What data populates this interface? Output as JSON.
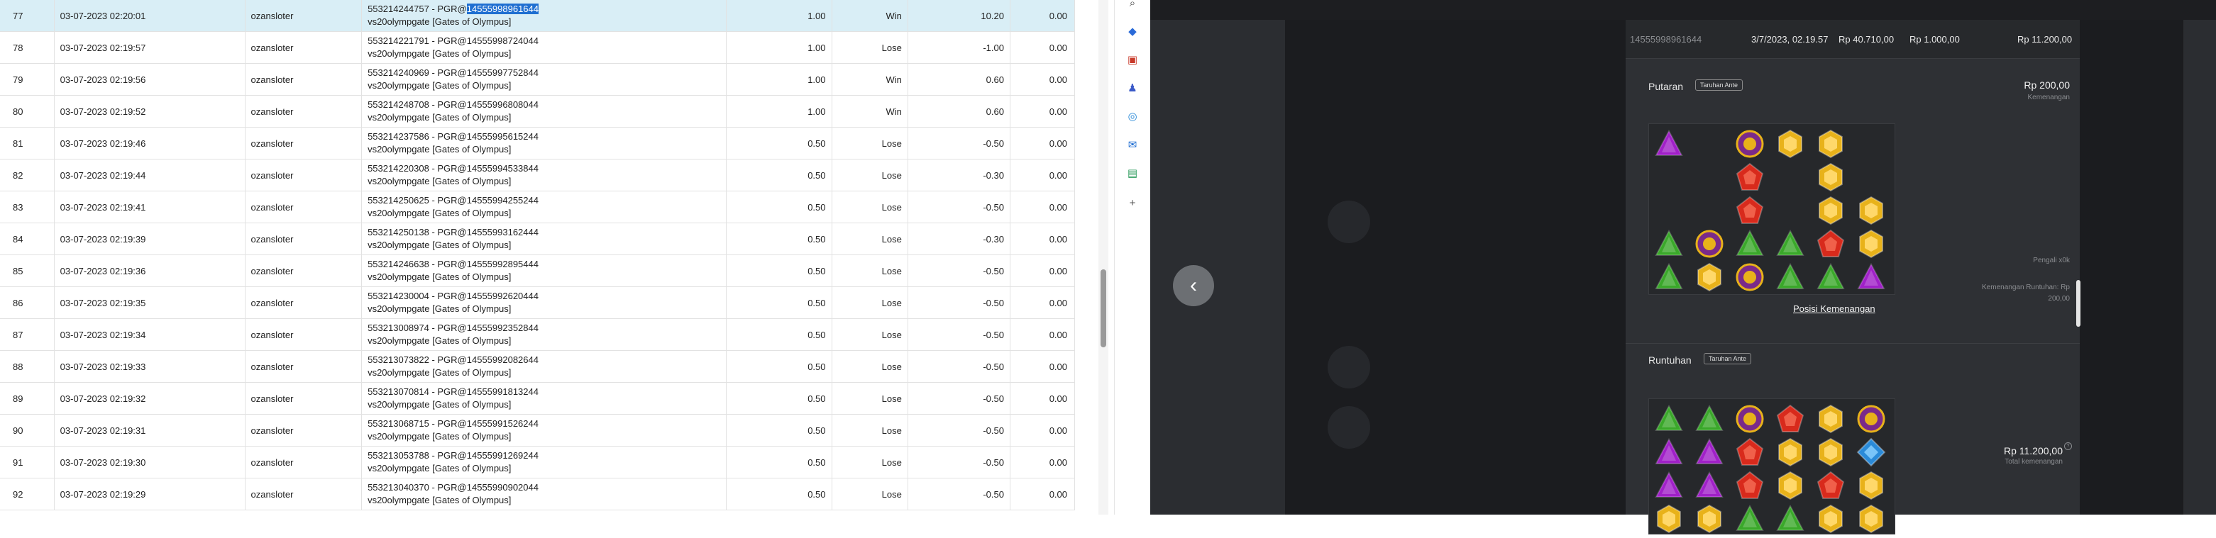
{
  "table": {
    "rows": [
      {
        "no": "77",
        "date": "03-07-2023 02:20:01",
        "user": "ozansloter",
        "tx_prefix": "553214244757 - PGR@",
        "tx_hl": "14555998961644",
        "game": "vs20olympgate [Gates of Olympus]",
        "bet": "1.00",
        "result": "Win",
        "win": "10.20",
        "extra": "0.00",
        "selected": true
      },
      {
        "no": "78",
        "date": "03-07-2023 02:19:57",
        "user": "ozansloter",
        "tx_prefix": "553214221791 - PGR@14555998724044",
        "tx_hl": "",
        "game": "vs20olympgate [Gates of Olympus]",
        "bet": "1.00",
        "result": "Lose",
        "win": "-1.00",
        "extra": "0.00"
      },
      {
        "no": "79",
        "date": "03-07-2023 02:19:56",
        "user": "ozansloter",
        "tx_prefix": "553214240969 - PGR@14555997752844",
        "tx_hl": "",
        "game": "vs20olympgate [Gates of Olympus]",
        "bet": "1.00",
        "result": "Win",
        "win": "0.60",
        "extra": "0.00"
      },
      {
        "no": "80",
        "date": "03-07-2023 02:19:52",
        "user": "ozansloter",
        "tx_prefix": "553214248708 - PGR@14555996808044",
        "tx_hl": "",
        "game": "vs20olympgate [Gates of Olympus]",
        "bet": "1.00",
        "result": "Win",
        "win": "0.60",
        "extra": "0.00"
      },
      {
        "no": "81",
        "date": "03-07-2023 02:19:46",
        "user": "ozansloter",
        "tx_prefix": "553214237586 - PGR@14555995615244",
        "tx_hl": "",
        "game": "vs20olympgate [Gates of Olympus]",
        "bet": "0.50",
        "result": "Lose",
        "win": "-0.50",
        "extra": "0.00"
      },
      {
        "no": "82",
        "date": "03-07-2023 02:19:44",
        "user": "ozansloter",
        "tx_prefix": "553214220308 - PGR@14555994533844",
        "tx_hl": "",
        "game": "vs20olympgate [Gates of Olympus]",
        "bet": "0.50",
        "result": "Lose",
        "win": "-0.30",
        "extra": "0.00"
      },
      {
        "no": "83",
        "date": "03-07-2023 02:19:41",
        "user": "ozansloter",
        "tx_prefix": "553214250625 - PGR@14555994255244",
        "tx_hl": "",
        "game": "vs20olympgate [Gates of Olympus]",
        "bet": "0.50",
        "result": "Lose",
        "win": "-0.50",
        "extra": "0.00"
      },
      {
        "no": "84",
        "date": "03-07-2023 02:19:39",
        "user": "ozansloter",
        "tx_prefix": "553214250138 - PGR@14555993162444",
        "tx_hl": "",
        "game": "vs20olympgate [Gates of Olympus]",
        "bet": "0.50",
        "result": "Lose",
        "win": "-0.30",
        "extra": "0.00"
      },
      {
        "no": "85",
        "date": "03-07-2023 02:19:36",
        "user": "ozansloter",
        "tx_prefix": "553214246638 - PGR@14555992895444",
        "tx_hl": "",
        "game": "vs20olympgate [Gates of Olympus]",
        "bet": "0.50",
        "result": "Lose",
        "win": "-0.50",
        "extra": "0.00"
      },
      {
        "no": "86",
        "date": "03-07-2023 02:19:35",
        "user": "ozansloter",
        "tx_prefix": "553214230004 - PGR@14555992620444",
        "tx_hl": "",
        "game": "vs20olympgate [Gates of Olympus]",
        "bet": "0.50",
        "result": "Lose",
        "win": "-0.50",
        "extra": "0.00"
      },
      {
        "no": "87",
        "date": "03-07-2023 02:19:34",
        "user": "ozansloter",
        "tx_prefix": "553213008974 - PGR@14555992352844",
        "tx_hl": "",
        "game": "vs20olympgate [Gates of Olympus]",
        "bet": "0.50",
        "result": "Lose",
        "win": "-0.50",
        "extra": "0.00"
      },
      {
        "no": "88",
        "date": "03-07-2023 02:19:33",
        "user": "ozansloter",
        "tx_prefix": "553213073822 - PGR@14555992082644",
        "tx_hl": "",
        "game": "vs20olympgate [Gates of Olympus]",
        "bet": "0.50",
        "result": "Lose",
        "win": "-0.50",
        "extra": "0.00"
      },
      {
        "no": "89",
        "date": "03-07-2023 02:19:32",
        "user": "ozansloter",
        "tx_prefix": "553213070814 - PGR@14555991813244",
        "tx_hl": "",
        "game": "vs20olympgate [Gates of Olympus]",
        "bet": "0.50",
        "result": "Lose",
        "win": "-0.50",
        "extra": "0.00"
      },
      {
        "no": "90",
        "date": "03-07-2023 02:19:31",
        "user": "ozansloter",
        "tx_prefix": "553213068715 - PGR@14555991526244",
        "tx_hl": "",
        "game": "vs20olympgate [Gates of Olympus]",
        "bet": "0.50",
        "result": "Lose",
        "win": "-0.50",
        "extra": "0.00"
      },
      {
        "no": "91",
        "date": "03-07-2023 02:19:30",
        "user": "ozansloter",
        "tx_prefix": "553213053788 - PGR@14555991269244",
        "tx_hl": "",
        "game": "vs20olympgate [Gates of Olympus]",
        "bet": "0.50",
        "result": "Lose",
        "win": "-0.50",
        "extra": "0.00"
      },
      {
        "no": "92",
        "date": "03-07-2023 02:19:29",
        "user": "ozansloter",
        "tx_prefix": "553213040370 - PGR@14555990902044",
        "tx_hl": "",
        "game": "vs20olympgate [Gates of Olympus]",
        "bet": "0.50",
        "result": "Lose",
        "win": "-0.50",
        "extra": "0.00"
      }
    ]
  },
  "sidebar_icons": [
    "search-icon",
    "tag-icon",
    "toolbox-icon",
    "chess-icon",
    "copilot-icon",
    "outlook-icon",
    "shopping-icon",
    "add-icon"
  ],
  "game": {
    "header": {
      "round_id": "14555998961644",
      "datetime": "3/7/2023, 02.19.57",
      "balance": "Rp 40.710,00",
      "bet": "Rp 1.000,00",
      "total": "Rp 11.200,00"
    },
    "spin": {
      "title": "Putaran",
      "badge": "Taruhan Ante",
      "win": "Rp 200,00",
      "win_label": "Kemenangan",
      "side_label": "Pengali x0k",
      "side_text": "Kemenangan Runtuhan: Rp 200,00",
      "link": "Posisi Kemenangan"
    },
    "tumble": {
      "title": "Runtuhan",
      "badge": "Taruhan Ante",
      "total": "Rp 11.200,00",
      "total_label": "Total kemenangan"
    },
    "colors": {
      "purple": "#a020c8",
      "gold": "#e8b21a",
      "red": "#d82a1c",
      "green": "#3aa82a",
      "blue": "#2a8ad8",
      "crown": "#7a2a8a"
    },
    "grid1": [
      [
        "purple",
        "",
        "crown",
        "gold",
        "gold",
        ""
      ],
      [
        "",
        "",
        "red",
        "",
        "gold",
        ""
      ],
      [
        "",
        "",
        "red",
        "",
        "gold",
        "gold"
      ],
      [
        "green",
        "crown",
        "green",
        "green",
        "red",
        "gold"
      ],
      [
        "green",
        "gold",
        "crown",
        "green",
        "green",
        "purple"
      ]
    ],
    "grid2": [
      [
        "green",
        "green",
        "crown",
        "red",
        "gold",
        "crown"
      ],
      [
        "purple",
        "purple",
        "red",
        "gold",
        "gold",
        "blue"
      ],
      [
        "purple",
        "purple",
        "red",
        "gold",
        "red",
        "gold"
      ],
      [
        "gold",
        "gold",
        "green",
        "green",
        "gold",
        "gold"
      ]
    ]
  }
}
